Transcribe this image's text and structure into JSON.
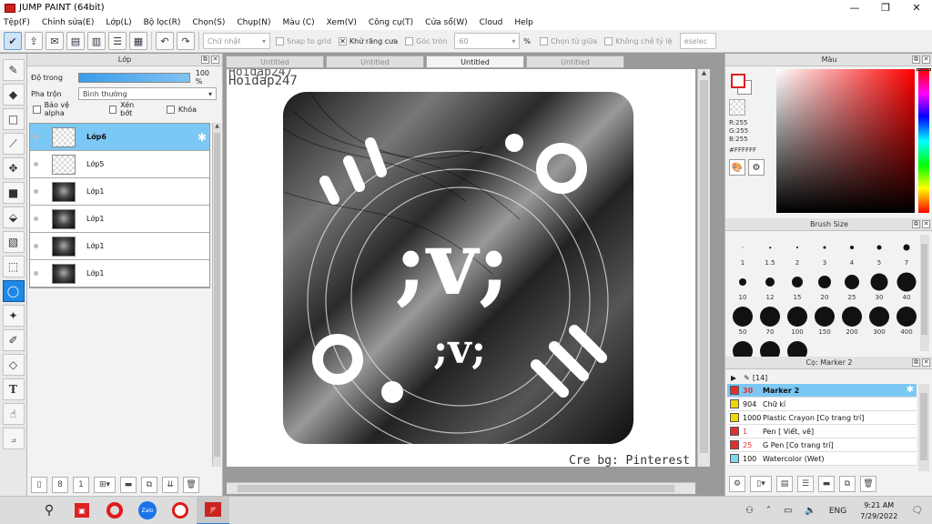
{
  "window": {
    "title": "JUMP PAINT (64bit)",
    "controls": [
      "—",
      "❐",
      "✕"
    ]
  },
  "menu": [
    "Tệp(F)",
    "Chỉnh sửa(E)",
    "Lớp(L)",
    "Bộ lọc(R)",
    "Chọn(S)",
    "Chụp(N)",
    "Màu (C)",
    "Xem(V)",
    "Công cụ(T)",
    "Cửa sổ(W)",
    "Cloud",
    "Help"
  ],
  "toolbar": {
    "shape_select": "Chữ nhật",
    "snap_to_grid": "Snap to grid",
    "antialias": "Khử răng cưa",
    "corner_round": "Góc tròn",
    "corner_value": "60",
    "percent_sign": "%",
    "select_center": "Chọn từ giữa",
    "fixed_ratio": "Không chế tỷ lệ",
    "deselect": "eselec"
  },
  "layer_panel": {
    "title": "Lớp",
    "opacity_label": "Độ trong",
    "opacity_value": "100 %",
    "opacity_fraction": 1.0,
    "blend_label": "Pha trộn",
    "blend_value": "Bình thường",
    "protect_alpha": "Bảo vệ alpha",
    "clipping": "Xén bớt",
    "lock": "Khóa",
    "layers": [
      {
        "name": "Lớp6",
        "thumb": "transparent",
        "selected": true
      },
      {
        "name": "Lớp5",
        "thumb": "transparent",
        "selected": false
      },
      {
        "name": "Lớp1",
        "thumb": "photo",
        "selected": false
      },
      {
        "name": "Lớp1",
        "thumb": "photo",
        "selected": false
      },
      {
        "name": "Lớp1",
        "thumb": "photo",
        "selected": false
      },
      {
        "name": "Lớp1",
        "thumb": "photo",
        "selected": false
      }
    ]
  },
  "canvas": {
    "tabs": [
      "Untitled",
      "Untitled",
      "Untitled",
      "Untitled"
    ],
    "active_tab": 2,
    "watermark_top": "Hoidap247",
    "watermark_name": "Hoidap247",
    "credit": "Cre bg: Pinterest",
    "emoticon_big": ";v;",
    "emoticon_small": ";v;"
  },
  "color_panel": {
    "title": "Màu",
    "r": "R:255",
    "g": "G:255",
    "b": "B:255",
    "hex": "#FFFFFF",
    "hue_color": "#ff0000"
  },
  "brush_panel": {
    "title": "Brush Size",
    "sizes": [
      "1",
      "1.5",
      "2",
      "3",
      "4",
      "5",
      "7",
      "10",
      "12",
      "15",
      "20",
      "25",
      "30",
      "40",
      "50",
      "70",
      "100",
      "150",
      "200",
      "300",
      "400",
      "",
      "",
      ""
    ]
  },
  "subtool_panel": {
    "title": "Cọ: Marker 2",
    "group": "[14]",
    "items": [
      {
        "num": "30",
        "name": "Marker 2",
        "color": "#e03030",
        "selected": true
      },
      {
        "num": "904",
        "name": "Chữ kí",
        "color": "#f0d800",
        "selected": false
      },
      {
        "num": "1000",
        "name": "Plastic Crayon [Cọ trang trí]",
        "color": "#f0d800",
        "selected": false
      },
      {
        "num": "1",
        "name": "Pen [ Viết, vẽ]",
        "color": "#e03030",
        "selected": false
      },
      {
        "num": "25",
        "name": "G Pen [Cọ trang trí]",
        "color": "#e03030",
        "selected": false
      },
      {
        "num": "100",
        "name": "Watercolor (Wet)",
        "color": "#7fd8f0",
        "selected": false
      }
    ]
  },
  "taskbar": {
    "lang": "ENG",
    "time": "9:21 AM",
    "date": "7/29/2022",
    "apps": [
      "search",
      "app-red",
      "opera",
      "zalo",
      "opera-gx",
      "jump-paint"
    ]
  }
}
